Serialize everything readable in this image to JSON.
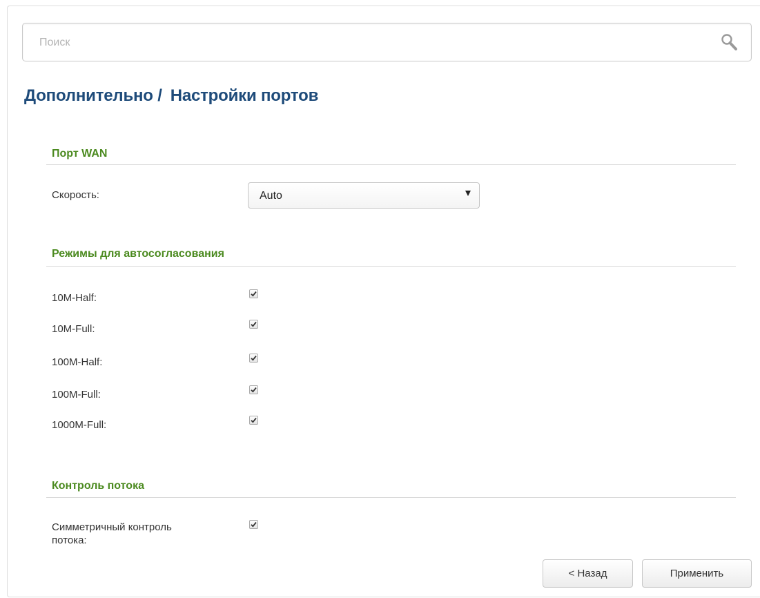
{
  "search": {
    "placeholder": "Поиск",
    "value": ""
  },
  "title": {
    "section": "Дополнительно /",
    "page": "Настройки портов"
  },
  "wan_port": {
    "heading": "Порт WAN",
    "speed_label": "Скорость:",
    "speed_value": "Auto"
  },
  "autoneg": {
    "heading": "Режимы для автосогласования",
    "modes": [
      {
        "label": "10M-Half:",
        "checked": true
      },
      {
        "label": "10M-Full:",
        "checked": true
      },
      {
        "label": "100M-Half:",
        "checked": true
      },
      {
        "label": "100M-Full:",
        "checked": true
      },
      {
        "label": "1000M-Full:",
        "checked": true
      }
    ]
  },
  "flow_control": {
    "heading": "Контроль потока",
    "symmetric_label_line1": "Симметричный контроль",
    "symmetric_label_line2": "потока:",
    "symmetric_checked": true
  },
  "buttons": {
    "back": "< Назад",
    "apply": "Применить"
  },
  "colors": {
    "title": "#1e4b7a",
    "section_heading": "#4b8a1f"
  },
  "icons": {
    "search": "search-icon",
    "checkmark": "checkmark-icon",
    "dropdown": "chevron-down-icon"
  }
}
